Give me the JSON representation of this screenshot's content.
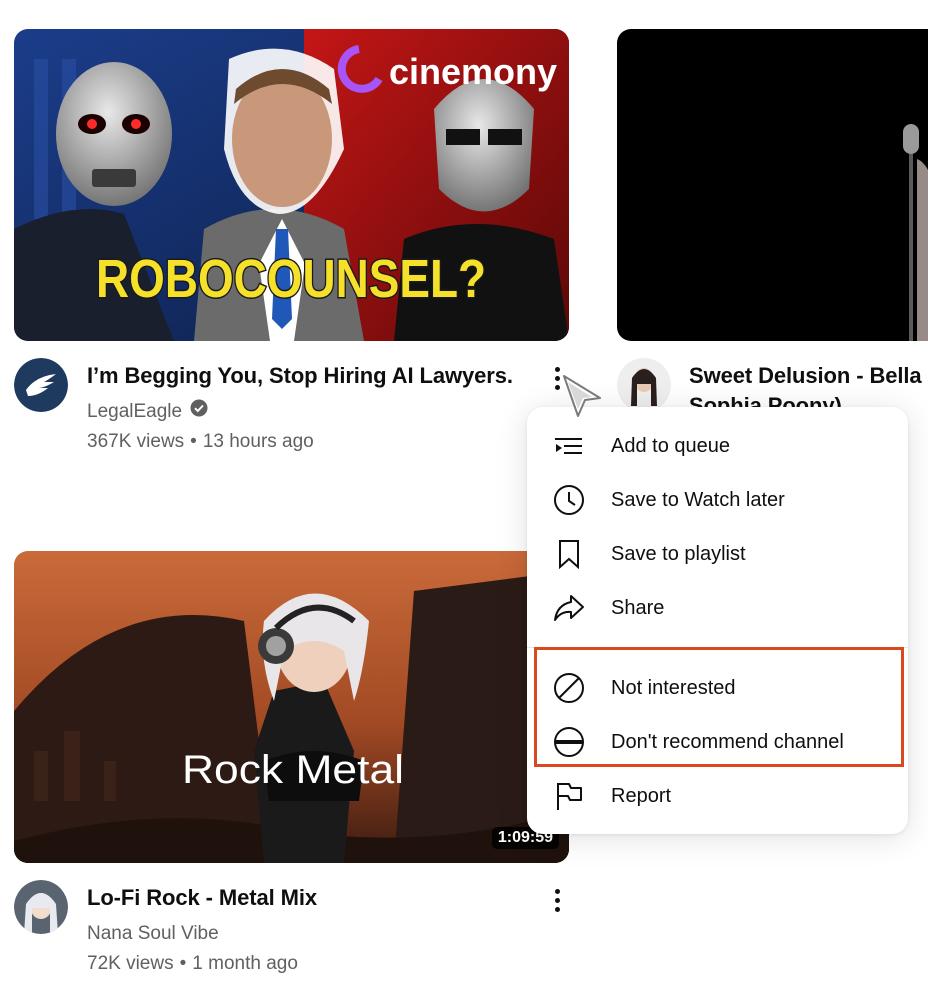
{
  "videos": [
    {
      "title": "I’m Begging You, Stop Hiring AI Lawyers.",
      "channel": "LegalEagle",
      "views": "367K views",
      "age": "13 hours ago",
      "thumbnail_text": "ROBOCOUNSEL?",
      "thumbnail_brand": "cinemony",
      "verified": true
    },
    {
      "title_line1": "Sweet Delusion - Bella",
      "title_line2": "Sophia Poony)"
    },
    {
      "title": "Lo-Fi Rock - Metal Mix",
      "channel": "Nana Soul Vibe",
      "views": "72K views",
      "age": "1 month ago",
      "thumbnail_text": "Rock Metal",
      "duration": "1:09:59"
    }
  ],
  "separator": "•",
  "menu": {
    "items": [
      {
        "label": "Add to queue",
        "icon": "queue-icon"
      },
      {
        "label": "Save to Watch later",
        "icon": "clock-icon"
      },
      {
        "label": "Save to playlist",
        "icon": "bookmark-icon"
      },
      {
        "label": "Share",
        "icon": "share-icon"
      },
      {
        "label": "Not interested",
        "icon": "block-icon"
      },
      {
        "label": "Don't recommend channel",
        "icon": "minus-circle-icon"
      },
      {
        "label": "Report",
        "icon": "flag-icon"
      }
    ]
  },
  "colors": {
    "highlight": "#d9481f",
    "legaleagle_brand": "#1f3a5f",
    "thumb_title_yellow": "#f5e12a"
  }
}
